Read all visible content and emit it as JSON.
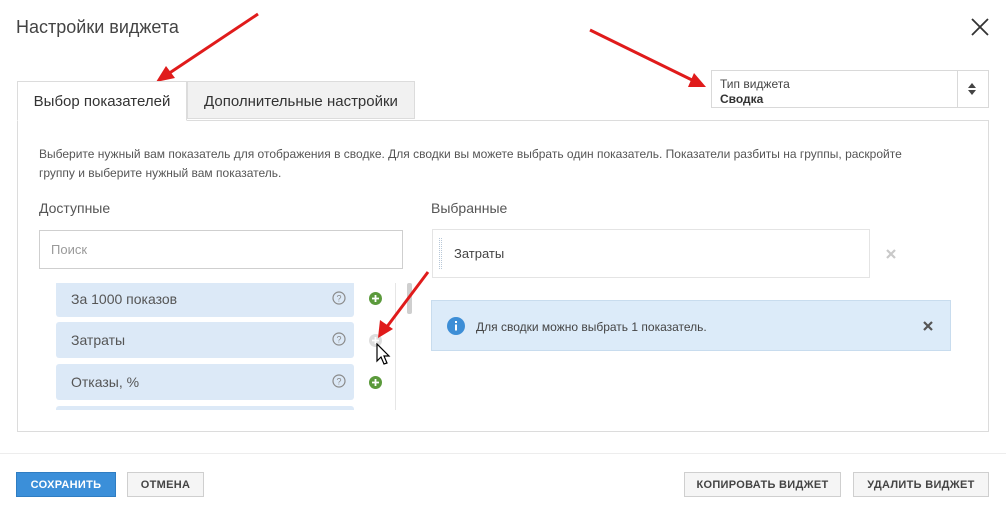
{
  "dialog": {
    "title": "Настройки виджета"
  },
  "tabs": [
    {
      "label": "Выбор показателей",
      "active": true
    },
    {
      "label": "Дополнительные настройки",
      "active": false
    }
  ],
  "widget_type": {
    "label": "Тип виджета",
    "value": "Сводка"
  },
  "description": "Выберите нужный вам показатель для отображения в сводке. Для сводки вы можете выбрать один показатель. Показатели разбиты на группы, раскройте группу и выберите нужный вам показатель.",
  "available": {
    "label": "Доступные",
    "search_placeholder": "Поиск",
    "items": [
      {
        "label": "За 1000 показов",
        "add_icon": "plus-circle-icon"
      },
      {
        "label": "Затраты",
        "add_icon": "plus-circle-icon"
      },
      {
        "label": "Отказы, %",
        "add_icon": "plus-circle-icon"
      }
    ]
  },
  "selected": {
    "label": "Выбранные",
    "items": [
      {
        "label": "Затраты"
      }
    ]
  },
  "info": {
    "text": "Для сводки можно выбрать 1 показатель."
  },
  "footer": {
    "save": "СОХРАНИТЬ",
    "cancel": "ОТМЕНА",
    "copy": "КОПИРОВАТЬ ВИДЖЕТ",
    "delete": "УДАЛИТЬ ВИДЖЕТ"
  },
  "colors": {
    "accent": "#3b8fd9",
    "metric_bg": "#dce9f7",
    "info_bg": "#dcebf9",
    "add_icon": "#5b9a3c",
    "annotation_arrow": "#e01b1b"
  }
}
